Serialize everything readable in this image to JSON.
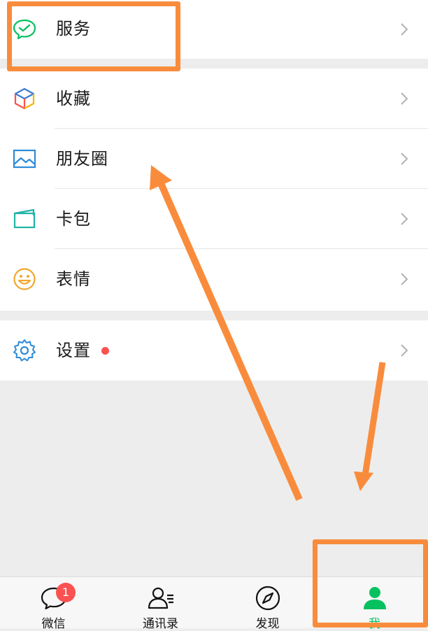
{
  "menu": {
    "services": {
      "label": "服务",
      "icon": "wechat-pay-icon"
    },
    "items": [
      {
        "label": "收藏",
        "icon": "favorites-cube-icon"
      },
      {
        "label": "朋友圈",
        "icon": "moments-picture-icon"
      },
      {
        "label": "卡包",
        "icon": "card-wallet-icon"
      },
      {
        "label": "表情",
        "icon": "smiley-icon"
      }
    ],
    "settings": {
      "label": "设置",
      "icon": "gear-icon",
      "has_red_dot": true
    }
  },
  "tabbar": {
    "tabs": [
      {
        "label": "微信",
        "icon": "chat-bubble-icon",
        "badge": "1",
        "active": false
      },
      {
        "label": "通讯录",
        "icon": "contacts-icon",
        "active": false
      },
      {
        "label": "发现",
        "icon": "compass-icon",
        "active": false
      },
      {
        "label": "我",
        "icon": "person-icon",
        "active": true
      }
    ]
  },
  "colors": {
    "accent_green": "#07c160",
    "badge_red": "#fa5151",
    "annotation_orange": "#f98c3c",
    "background": "#ededed"
  },
  "annotations": [
    {
      "type": "highlight-box",
      "target": "services"
    },
    {
      "type": "highlight-box",
      "target": "tab-me"
    },
    {
      "type": "arrow",
      "from": "tab-me",
      "to": "moments"
    },
    {
      "type": "arrow",
      "from": "tab-me",
      "to": "tab-me"
    }
  ]
}
